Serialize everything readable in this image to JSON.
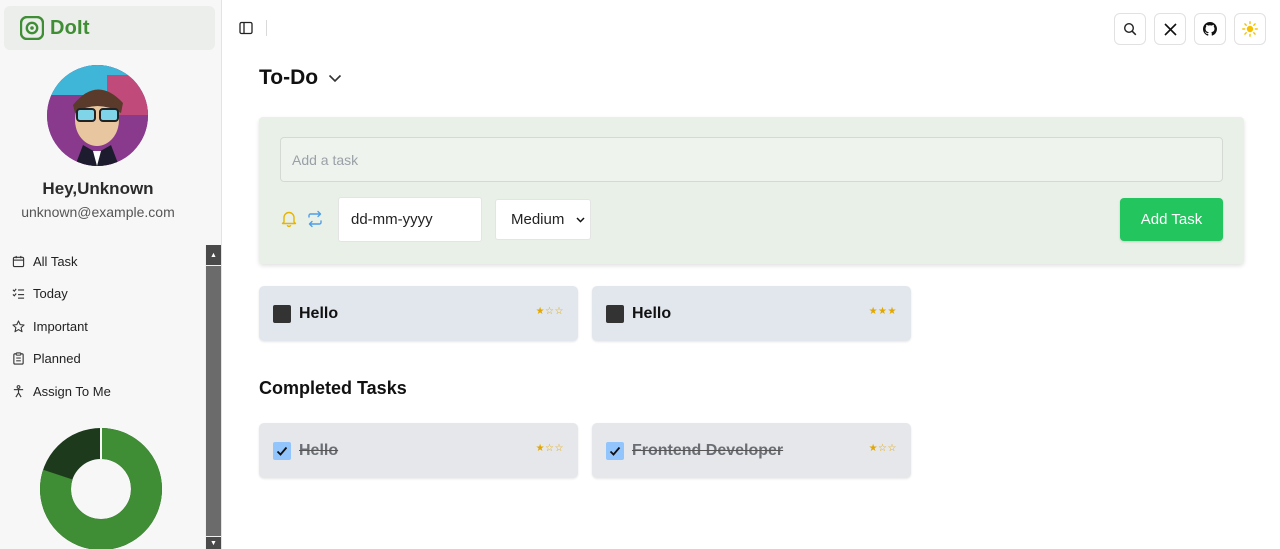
{
  "brand": {
    "name": "DoIt",
    "icon": "doit-logo-icon",
    "color": "#3f8d34"
  },
  "profile": {
    "greeting": "Hey,Unknown",
    "email": "unknown@example.com"
  },
  "nav": {
    "items": [
      {
        "label": "All Task",
        "icon": "calendar-icon"
      },
      {
        "label": "Today",
        "icon": "list-check-icon"
      },
      {
        "label": "Important",
        "icon": "star-icon"
      },
      {
        "label": "Planned",
        "icon": "clipboard-icon"
      },
      {
        "label": "Assign To Me",
        "icon": "person-icon"
      }
    ]
  },
  "stats_chart": {
    "type": "donut",
    "completed_fraction": 0.8,
    "pending_fraction": 0.2,
    "colors": {
      "completed": "#3f8d34",
      "pending": "#1d3a1d"
    }
  },
  "topbar": {
    "icons": [
      "search-icon",
      "x-logo-icon",
      "github-icon",
      "sun-icon"
    ]
  },
  "main": {
    "title": "To-Do",
    "composer": {
      "placeholder": "Add a task",
      "date_placeholder": "dd-mm-yyyy",
      "priority": "Medium",
      "add_label": "Add Task"
    },
    "tasks": [
      {
        "title": "Hello",
        "stars": "★☆☆"
      },
      {
        "title": "Hello",
        "stars": "★★★"
      }
    ],
    "completed_title": "Completed Tasks",
    "completed": [
      {
        "title": "Hello",
        "stars": "★☆☆"
      },
      {
        "title": "Frontend Developer",
        "stars": "★☆☆"
      }
    ]
  },
  "colors": {
    "accent": "#22c55e",
    "composer_bg": "#e9f0e8",
    "star": "#e2a700"
  }
}
